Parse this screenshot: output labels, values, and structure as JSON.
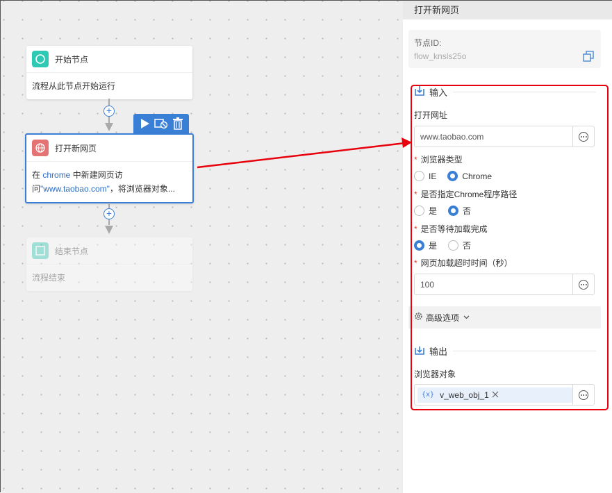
{
  "canvas": {
    "start_node": {
      "title": "开始节点",
      "desc": "流程从此节点开始运行"
    },
    "open_node": {
      "title": "打开新网页",
      "desc_prefix": "在 ",
      "desc_kw1": "chrome",
      "desc_mid": " 中新建网页访问",
      "desc_kw2": "\"www.taobao.com\"",
      "desc_suffix": "，将浏览器对象..."
    },
    "end_node": {
      "title": "结束节点",
      "desc": "流程结束"
    },
    "toolbar": {
      "run_icon": "play-icon",
      "disable_icon": "disable-icon",
      "delete_icon": "trash-icon"
    }
  },
  "panel": {
    "title": "打开新网页",
    "node_id_label": "节点ID:",
    "node_id_value": "flow_knsls25o",
    "input_section": "输入",
    "url_label": "打开网址",
    "url_value": "www.taobao.com",
    "browser_type_label": "浏览器类型",
    "browser_options": [
      "IE",
      "Chrome"
    ],
    "browser_selected": "Chrome",
    "chrome_path_label": "是否指定Chrome程序路径",
    "chrome_path_options": [
      "是",
      "否"
    ],
    "chrome_path_selected": "否",
    "wait_label": "是否等待加载完成",
    "wait_options": [
      "是",
      "否"
    ],
    "wait_selected": "是",
    "timeout_label": "网页加载超时时间（秒）",
    "timeout_value": "100",
    "advanced_label": "高级选项",
    "output_section": "输出",
    "browser_obj_label": "浏览器对象",
    "browser_obj_var_icon": "{x}",
    "browser_obj_value": "v_web_obj_1"
  },
  "colors": {
    "accent": "#3a7fd6",
    "highlight": "#e8000c",
    "start_icon": "#2ec9b5",
    "open_icon": "#e57373"
  }
}
